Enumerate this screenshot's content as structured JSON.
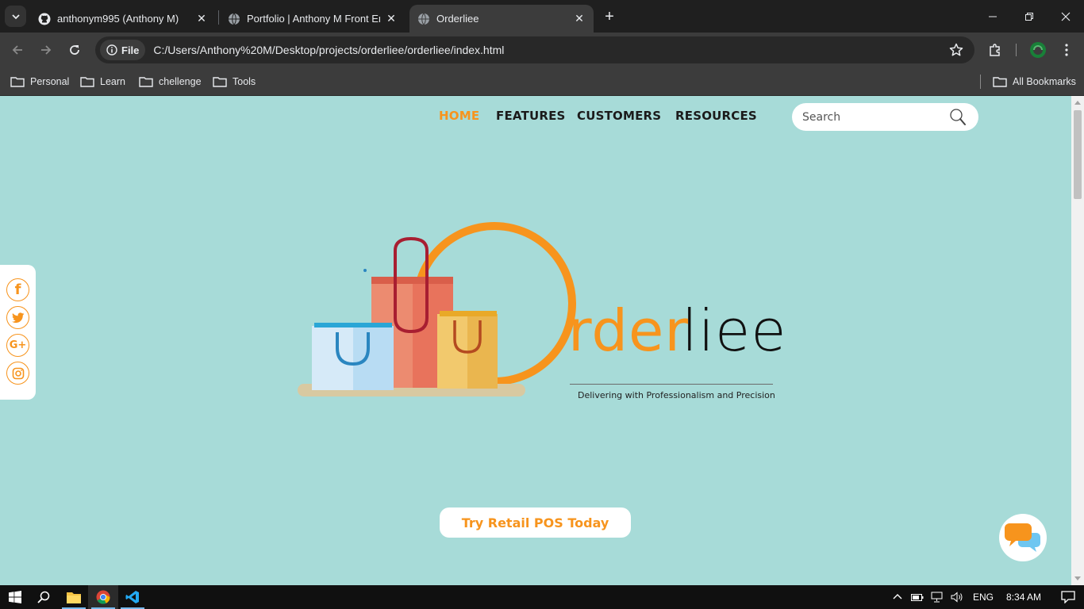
{
  "browser": {
    "tabs": [
      {
        "title": "anthonym995 (Anthony M)",
        "icon": "github-icon"
      },
      {
        "title": "Portfolio | Anthony M Front End",
        "icon": "globe-icon"
      },
      {
        "title": "Orderliee",
        "icon": "globe-icon",
        "active": true
      }
    ],
    "omnibox": {
      "chip_label": "File",
      "url": "C:/Users/Anthony%20M/Desktop/projects/orderliee/orderliee/index.html"
    },
    "bookmarks": [
      "Personal",
      "Learn",
      "chellenge",
      "Tools"
    ],
    "all_bookmarks": "All Bookmarks"
  },
  "site": {
    "nav": [
      "HOME",
      "FEATURES",
      "CUSTOMERS",
      "RESOURCES"
    ],
    "active_nav": "HOME",
    "search_placeholder": "Search",
    "social": [
      "facebook-icon",
      "twitter-icon",
      "google-plus-icon",
      "instagram-icon"
    ],
    "logo": {
      "word_orange": "rder",
      "word_black": "liee",
      "tagline": "Delivering with Professionalism and Precision"
    },
    "cta_label": "Try Retail POS Today",
    "colors": {
      "accent": "#f7941d",
      "background": "#a7dbd8",
      "bag_blue": "#cfe6f6",
      "bag_red": "#e8735c",
      "bag_yellow": "#f1c15a"
    }
  },
  "taskbar": {
    "language": "ENG",
    "time": "8:34 AM"
  }
}
